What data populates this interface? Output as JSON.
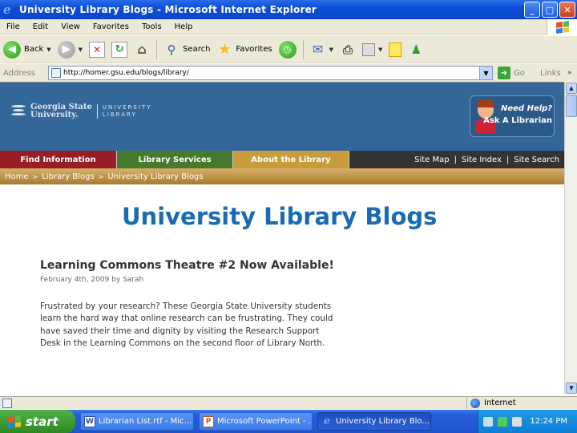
{
  "window": {
    "title": "University Library Blogs - Microsoft Internet Explorer",
    "buttons": [
      "_",
      "□",
      "✕"
    ]
  },
  "menu": [
    "File",
    "Edit",
    "View",
    "Favorites",
    "Tools",
    "Help"
  ],
  "toolbar": {
    "back_label": "Back",
    "search_label": "Search",
    "favorites_label": "Favorites"
  },
  "address": {
    "label": "Address",
    "url": "http://homer.gsu.edu/blogs/library/",
    "go_label": "Go",
    "links_label": "Links",
    "more": "»"
  },
  "site": {
    "logo_name_line1": "Georgia State",
    "logo_name_line2": "University.",
    "logo_lib_line1": "UNIVERSITY",
    "logo_lib_line2": "LIBRARY",
    "ask_line1": "Need Help?",
    "ask_line2": "Ask A Librarian",
    "nav": [
      "Find Information",
      "Library Services",
      "About the Library"
    ],
    "site_links": [
      "Site Map",
      "Site Index",
      "Site Search"
    ],
    "breadcrumb": [
      "Home",
      "Library Blogs",
      "University Library Blogs"
    ]
  },
  "page": {
    "title": "University Library Blogs",
    "post_title": "Learning Commons Theatre #2 Now Available!",
    "post_meta": "February 4th, 2009 by Sarah",
    "post_body_lines": [
      "Frustrated by your research? These Georgia State University students",
      "learn the hard way that online research can be frustrating. They could",
      "have saved their time and dignity by visiting the Research Support",
      "Desk in the Learning Commons on the second floor of Library North."
    ]
  },
  "status": {
    "zone": "Internet"
  },
  "taskbar": {
    "start_label": "start",
    "tasks": [
      "Librarian List.rtf - Mic...",
      "Microsoft PowerPoint - ...",
      "University Library Blo..."
    ],
    "clock": "12:24 PM"
  },
  "colors": {
    "header_blue": "#336699",
    "nav_red": "#9b1d24",
    "nav_green": "#487a2e",
    "nav_gold": "#c89b3c",
    "title_blue": "#1a6bb4"
  }
}
